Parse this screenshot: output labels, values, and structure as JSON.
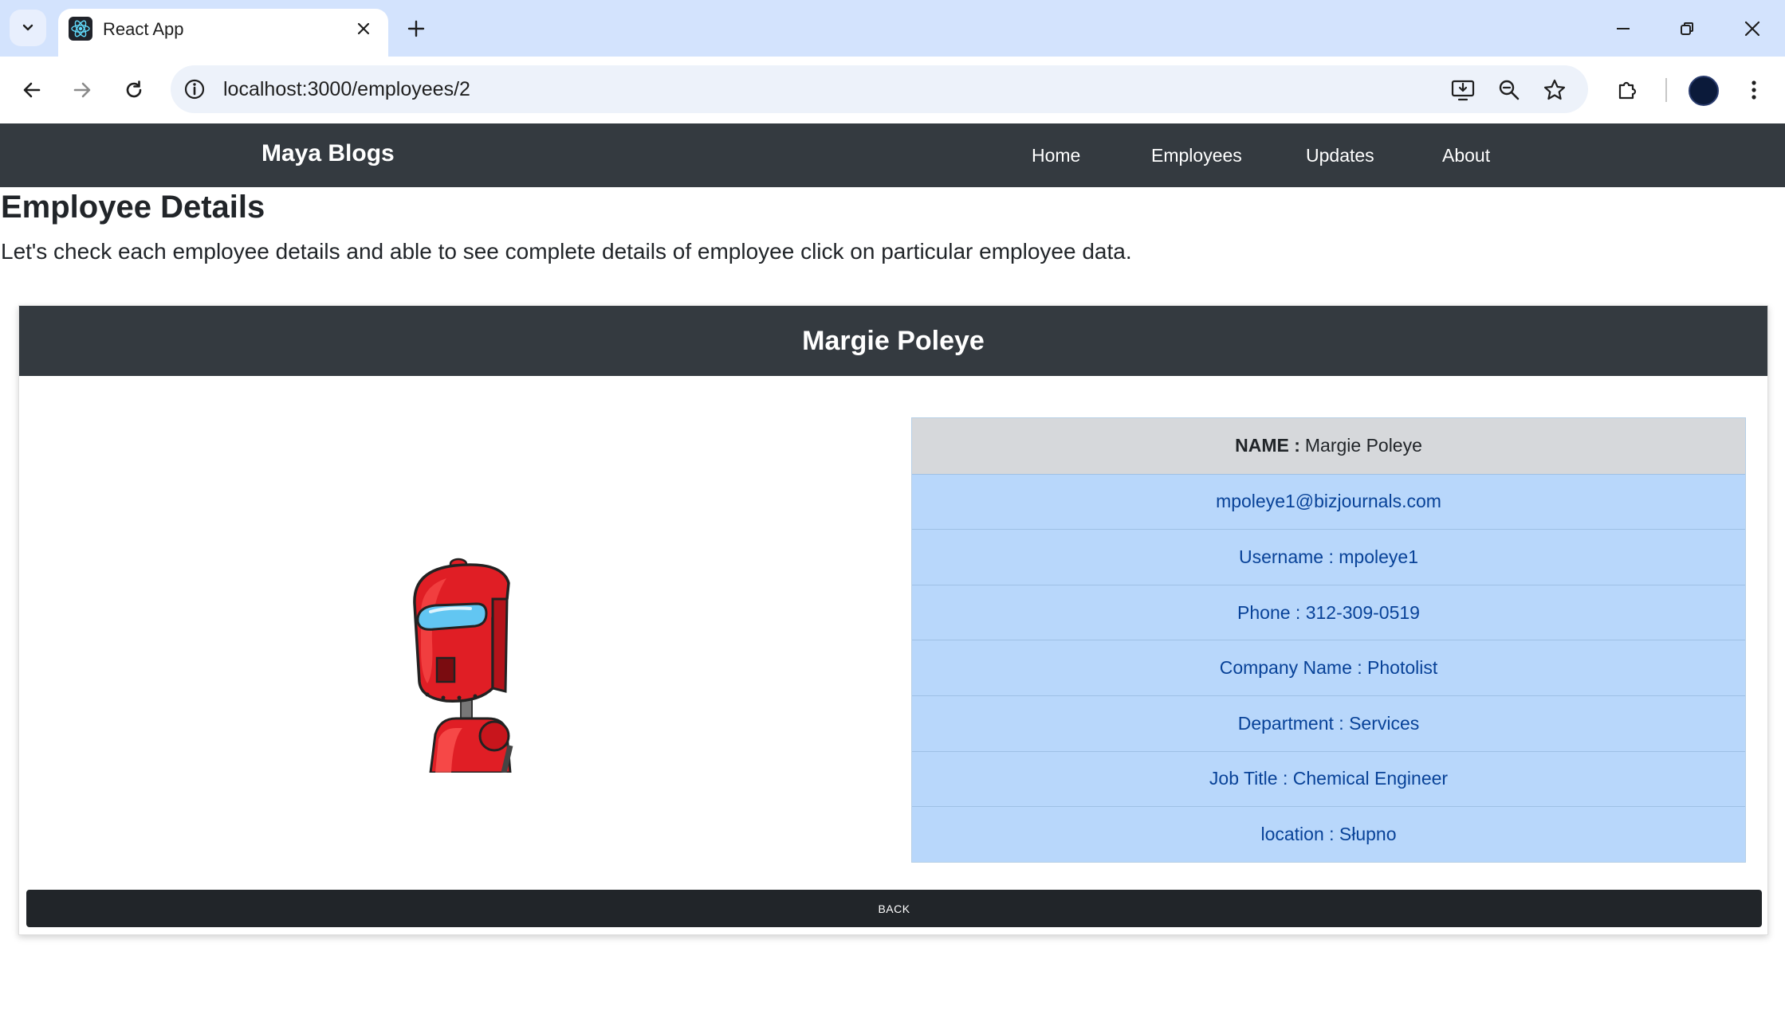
{
  "browser": {
    "tab_title": "React App",
    "url": "localhost:3000/employees/2"
  },
  "app": {
    "brand": "Maya Blogs",
    "nav": [
      "Home",
      "Employees",
      "Updates",
      "About"
    ]
  },
  "page": {
    "title": "Employee Details",
    "lead": "Let's check each employee details and able to see complete details of employee click on particular employee data."
  },
  "employee": {
    "header_name": "Margie Poleye",
    "name_label": "NAME :",
    "name_value": "Margie Poleye",
    "email": "mpoleye1@bizjournals.com",
    "username": "Username : mpoleye1",
    "phone": "Phone : 312-309-0519",
    "company": "Company Name : Photolist",
    "department": "Department : Services",
    "job_title": "Job Title : Chemical Engineer",
    "location": "location : Słupno"
  },
  "actions": {
    "back_label": "BACK"
  },
  "colors": {
    "navbar": "#343a40",
    "row_info": "#b8d7fb",
    "row_head": "#d6d8db",
    "button_dark": "#212529"
  }
}
